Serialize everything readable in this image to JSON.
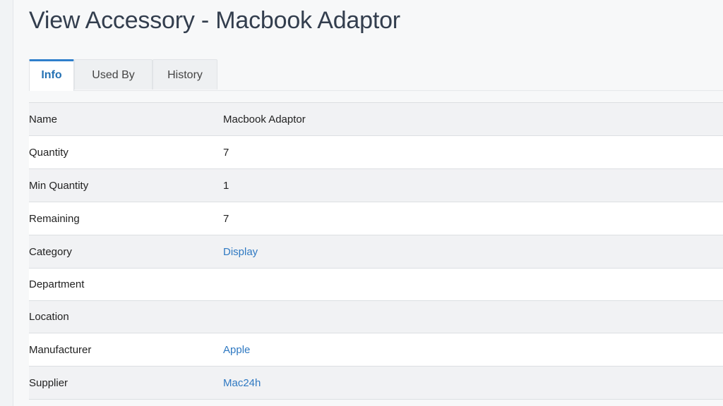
{
  "page": {
    "title": "View Accessory - Macbook Adaptor"
  },
  "tabs": [
    {
      "label": "Info",
      "active": true
    },
    {
      "label": "Used By",
      "active": false
    },
    {
      "label": "History",
      "active": false
    }
  ],
  "details": {
    "rows": [
      {
        "label": "Name",
        "value": "Macbook Adaptor",
        "link": false
      },
      {
        "label": "Quantity",
        "value": "7",
        "link": false
      },
      {
        "label": "Min Quantity",
        "value": "1",
        "link": false
      },
      {
        "label": "Remaining",
        "value": "7",
        "link": false
      },
      {
        "label": "Category",
        "value": "Display",
        "link": true
      },
      {
        "label": "Department",
        "value": "",
        "link": false
      },
      {
        "label": "Location",
        "value": "",
        "link": false
      },
      {
        "label": "Manufacturer",
        "value": "Apple",
        "link": true
      },
      {
        "label": "Supplier",
        "value": "Mac24h",
        "link": true
      }
    ]
  },
  "colors": {
    "title": "#333e4e",
    "link": "#2f79c2",
    "active_tab": "#2572b4"
  }
}
